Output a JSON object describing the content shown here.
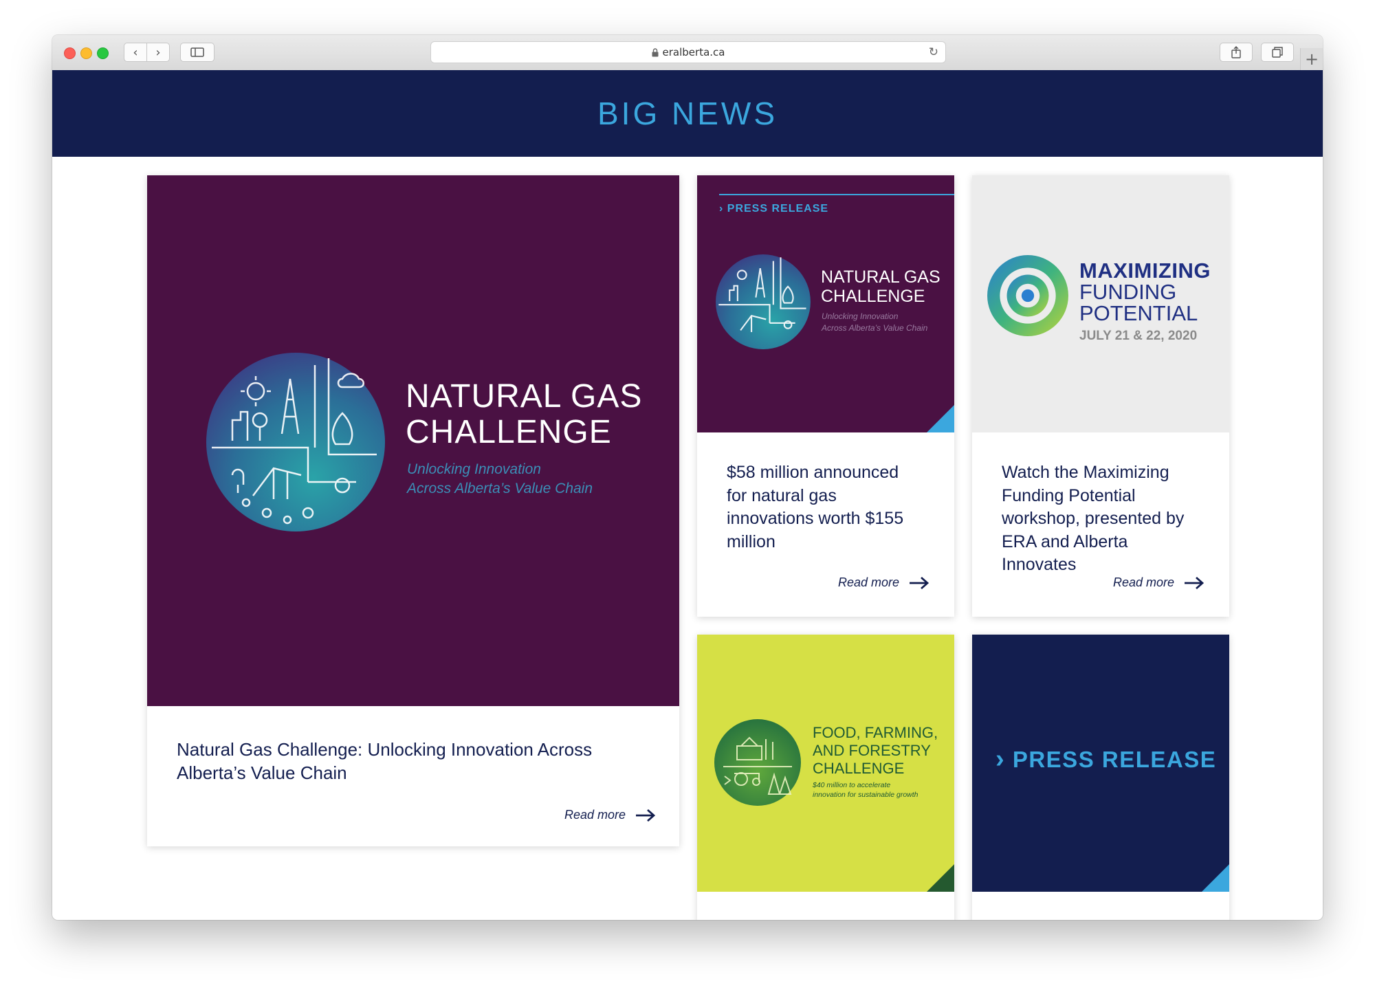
{
  "browser": {
    "url": "eralberta.ca",
    "back_label": "‹",
    "forward_label": "›",
    "new_tab_label": "+"
  },
  "page": {
    "heading": "BIG NEWS"
  },
  "featured": {
    "logo_title_line1": "NATURAL GAS",
    "logo_title_line2": "CHALLENGE",
    "logo_sub_line1": "Unlocking Innovation",
    "logo_sub_line2": "Across Alberta’s Value Chain",
    "title_line1": "Natural Gas Challenge: Unlocking Innovation Across",
    "title_line2": "Alberta’s Value Chain",
    "read_more": "Read more"
  },
  "card_gas": {
    "tag": "PRESS RELEASE",
    "logo_title_line1": "NATURAL GAS",
    "logo_title_line2": "CHALLENGE",
    "logo_sub_line1": "Unlocking Innovation",
    "logo_sub_line2": "Across Alberta’s Value Chain",
    "title_lines": [
      "$58 million announced",
      "for natural gas",
      "innovations worth $155",
      "million"
    ],
    "read_more": "Read more"
  },
  "card_funding": {
    "logo_line1": "MAXIMIZING",
    "logo_line2": "FUNDING",
    "logo_line3": "POTENTIAL",
    "date": "JULY 21 & 22, 2020",
    "title_lines": [
      "Watch the Maximizing",
      "Funding Potential",
      "workshop, presented by",
      "ERA and Alberta",
      "Innovates"
    ],
    "read_more": "Read more"
  },
  "card_food": {
    "logo_line1": "FOOD, FARMING,",
    "logo_line2": "AND FORESTRY",
    "logo_line3": "CHALLENGE",
    "logo_sub_line1": "$40 million to accelerate",
    "logo_sub_line2": "innovation for sustainable growth"
  },
  "card_press": {
    "label": "PRESS RELEASE"
  },
  "colors": {
    "navy": "#131e4f",
    "plum": "#4a1143",
    "accent_blue": "#3ba7de",
    "lime": "#d6e045",
    "light_gray": "#ececec"
  }
}
